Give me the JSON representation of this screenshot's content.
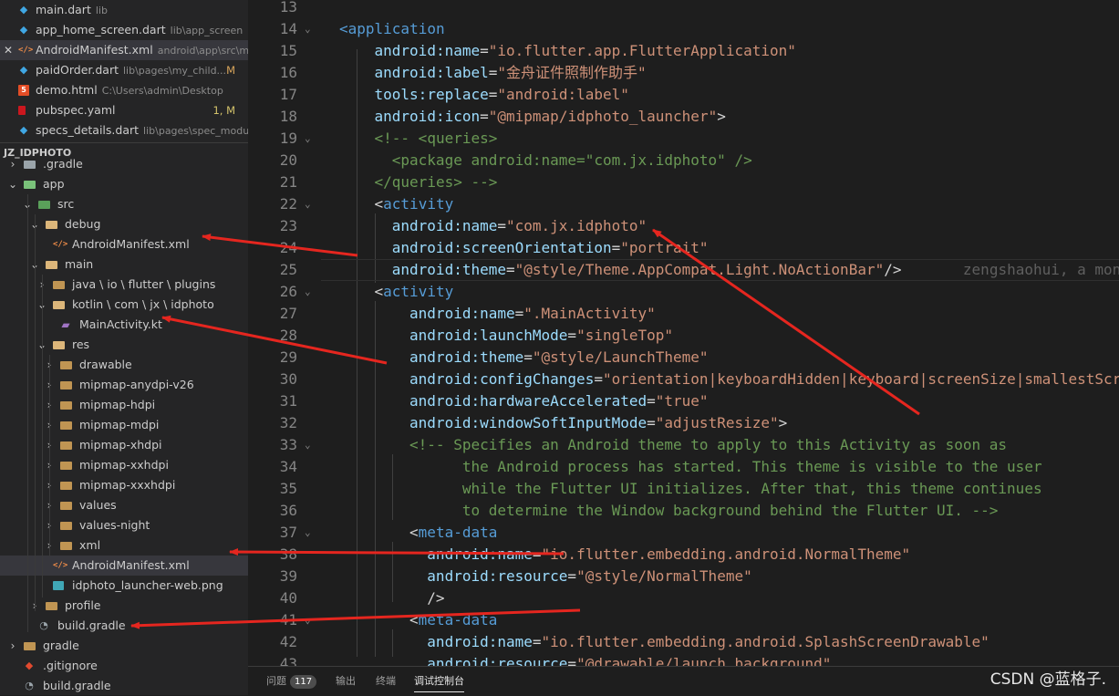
{
  "open_editors": [
    {
      "name": "main.dart",
      "hint": "lib",
      "icon": "dart",
      "badge": ""
    },
    {
      "name": "app_home_screen.dart",
      "hint": "lib\\app_screen",
      "icon": "dart",
      "badge": ""
    },
    {
      "name": "AndroidManifest.xml",
      "hint": "android\\app\\src\\m...",
      "icon": "xml",
      "badge": "",
      "selected": true
    },
    {
      "name": "paidOrder.dart",
      "hint": "lib\\pages\\my_child...",
      "icon": "dart",
      "badge": "M"
    },
    {
      "name": "demo.html",
      "hint": "C:\\Users\\admin\\Desktop",
      "icon": "html",
      "badge": ""
    },
    {
      "name": "pubspec.yaml",
      "hint": "",
      "icon": "yaml",
      "badge": "1, M"
    },
    {
      "name": "specs_details.dart",
      "hint": "lib\\pages\\spec_module",
      "icon": "dart",
      "badge": ""
    }
  ],
  "close_glyph": "✕",
  "workspace_title": "JZ_IDPHOTO",
  "tree": [
    {
      "label": ".gradle",
      "depth": 0,
      "kind": "folder-gr",
      "chev": "›"
    },
    {
      "label": "app",
      "depth": 0,
      "kind": "folder-app",
      "chev": "⌄"
    },
    {
      "label": "src",
      "depth": 1,
      "kind": "folder-src",
      "chev": "⌄"
    },
    {
      "label": "debug",
      "depth": 2,
      "kind": "folder-open",
      "chev": "⌄"
    },
    {
      "label": "AndroidManifest.xml",
      "depth": 3,
      "kind": "xml",
      "chev": ""
    },
    {
      "label": "main",
      "depth": 2,
      "kind": "folder-open",
      "chev": "⌄"
    },
    {
      "label": "java \\ io \\ flutter \\ plugins",
      "depth": 3,
      "kind": "folder",
      "chev": "›"
    },
    {
      "label": "kotlin \\ com \\ jx \\ idphoto",
      "depth": 3,
      "kind": "folder-open",
      "chev": "⌄"
    },
    {
      "label": "MainActivity.kt",
      "depth": 4,
      "kind": "kt",
      "chev": ""
    },
    {
      "label": "res",
      "depth": 3,
      "kind": "folder-open",
      "chev": "⌄"
    },
    {
      "label": "drawable",
      "depth": 4,
      "kind": "folder",
      "chev": "›"
    },
    {
      "label": "mipmap-anydpi-v26",
      "depth": 4,
      "kind": "folder",
      "chev": "›"
    },
    {
      "label": "mipmap-hdpi",
      "depth": 4,
      "kind": "folder",
      "chev": "›"
    },
    {
      "label": "mipmap-mdpi",
      "depth": 4,
      "kind": "folder",
      "chev": "›"
    },
    {
      "label": "mipmap-xhdpi",
      "depth": 4,
      "kind": "folder",
      "chev": "›"
    },
    {
      "label": "mipmap-xxhdpi",
      "depth": 4,
      "kind": "folder",
      "chev": "›"
    },
    {
      "label": "mipmap-xxxhdpi",
      "depth": 4,
      "kind": "folder",
      "chev": "›"
    },
    {
      "label": "values",
      "depth": 4,
      "kind": "folder",
      "chev": "›"
    },
    {
      "label": "values-night",
      "depth": 4,
      "kind": "folder",
      "chev": "›"
    },
    {
      "label": "xml",
      "depth": 4,
      "kind": "folder",
      "chev": "›"
    },
    {
      "label": "AndroidManifest.xml",
      "depth": 3,
      "kind": "xml",
      "chev": "",
      "selected": true
    },
    {
      "label": "idphoto_launcher-web.png",
      "depth": 3,
      "kind": "png",
      "chev": ""
    },
    {
      "label": "profile",
      "depth": 2,
      "kind": "folder",
      "chev": "›"
    },
    {
      "label": "build.gradle",
      "depth": 1,
      "kind": "gradle",
      "chev": ""
    },
    {
      "label": "gradle",
      "depth": 0,
      "kind": "folder",
      "chev": "›"
    },
    {
      "label": ".gitignore",
      "depth": 0,
      "kind": "git",
      "chev": ""
    },
    {
      "label": "build.gradle",
      "depth": 0,
      "kind": "gradle",
      "chev": ""
    }
  ],
  "editor": {
    "lines": [
      {
        "n": "13",
        "fold": "",
        "indent": 0,
        "tokens": []
      },
      {
        "n": "14",
        "fold": "⌄",
        "indent": 0,
        "tokens": [
          [
            "tag",
            "<application"
          ]
        ]
      },
      {
        "n": "15",
        "fold": "",
        "indent": 2,
        "tokens": [
          [
            "attr",
            "android:name"
          ],
          [
            "pl",
            "="
          ],
          [
            "str",
            "\"io.flutter.app.FlutterApplication\""
          ]
        ]
      },
      {
        "n": "16",
        "fold": "",
        "indent": 2,
        "tokens": [
          [
            "attr",
            "android:label"
          ],
          [
            "pl",
            "="
          ],
          [
            "str",
            "\"金舟证件照制作助手\""
          ]
        ]
      },
      {
        "n": "17",
        "fold": "",
        "indent": 2,
        "tokens": [
          [
            "attr",
            "tools:replace"
          ],
          [
            "pl",
            "="
          ],
          [
            "str",
            "\"android:label\""
          ]
        ]
      },
      {
        "n": "18",
        "fold": "",
        "indent": 2,
        "tokens": [
          [
            "attr",
            "android:icon"
          ],
          [
            "pl",
            "="
          ],
          [
            "str",
            "\"@mipmap/idphoto_launcher\""
          ],
          [
            "pl",
            ">"
          ]
        ]
      },
      {
        "n": "19",
        "fold": "⌄",
        "indent": 2,
        "tokens": [
          [
            "cm",
            "<!-- <queries>"
          ]
        ]
      },
      {
        "n": "20",
        "fold": "",
        "indent": 3,
        "tokens": [
          [
            "cm",
            "<package android:name=\"com.jx.idphoto\" />"
          ]
        ]
      },
      {
        "n": "21",
        "fold": "",
        "indent": 2,
        "tokens": [
          [
            "cm",
            "</queries> -->"
          ]
        ]
      },
      {
        "n": "22",
        "fold": "⌄",
        "indent": 2,
        "tokens": [
          [
            "pl",
            "<"
          ],
          [
            "tag",
            "activity"
          ]
        ]
      },
      {
        "n": "23",
        "fold": "",
        "indent": 3,
        "tokens": [
          [
            "attr",
            "android:name"
          ],
          [
            "pl",
            "="
          ],
          [
            "str",
            "\"com.jx.idphoto\""
          ]
        ]
      },
      {
        "n": "24",
        "fold": "",
        "indent": 3,
        "tokens": [
          [
            "attr",
            "android:screenOrientation"
          ],
          [
            "pl",
            "="
          ],
          [
            "str",
            "\"portrait\""
          ]
        ]
      },
      {
        "n": "25",
        "fold": "",
        "indent": 3,
        "current": true,
        "tokens": [
          [
            "attr",
            "android:theme"
          ],
          [
            "pl",
            "="
          ],
          [
            "str",
            "\"@style/Theme.AppCompat.Light.NoActionBar\""
          ],
          [
            "pl",
            "/>"
          ],
          [
            "blame",
            "       zengshaohui, a month ago"
          ]
        ]
      },
      {
        "n": "26",
        "fold": "⌄",
        "indent": 2,
        "tokens": [
          [
            "pl",
            "<"
          ],
          [
            "tag",
            "activity"
          ]
        ]
      },
      {
        "n": "27",
        "fold": "",
        "indent": 4,
        "tokens": [
          [
            "attr",
            "android:name"
          ],
          [
            "pl",
            "="
          ],
          [
            "str",
            "\".MainActivity\""
          ]
        ]
      },
      {
        "n": "28",
        "fold": "",
        "indent": 4,
        "tokens": [
          [
            "attr",
            "android:launchMode"
          ],
          [
            "pl",
            "="
          ],
          [
            "str",
            "\"singleTop\""
          ]
        ]
      },
      {
        "n": "29",
        "fold": "",
        "indent": 4,
        "tokens": [
          [
            "attr",
            "android:theme"
          ],
          [
            "pl",
            "="
          ],
          [
            "str",
            "\"@style/LaunchTheme\""
          ]
        ]
      },
      {
        "n": "30",
        "fold": "",
        "indent": 4,
        "tokens": [
          [
            "attr",
            "android:configChanges"
          ],
          [
            "pl",
            "="
          ],
          [
            "str",
            "\"orientation|keyboardHidden|keyboard|screenSize|smallestScreenSize\""
          ]
        ]
      },
      {
        "n": "31",
        "fold": "",
        "indent": 4,
        "tokens": [
          [
            "attr",
            "android:hardwareAccelerated"
          ],
          [
            "pl",
            "="
          ],
          [
            "str",
            "\"true\""
          ]
        ]
      },
      {
        "n": "32",
        "fold": "",
        "indent": 4,
        "tokens": [
          [
            "attr",
            "android:windowSoftInputMode"
          ],
          [
            "pl",
            "="
          ],
          [
            "str",
            "\"adjustResize\""
          ],
          [
            "pl",
            ">"
          ]
        ]
      },
      {
        "n": "33",
        "fold": "⌄",
        "indent": 4,
        "tokens": [
          [
            "cm",
            "<!-- Specifies an Android theme to apply to this Activity as soon as"
          ]
        ]
      },
      {
        "n": "34",
        "fold": "",
        "indent": 7,
        "tokens": [
          [
            "cm",
            "the Android process has started. This theme is visible to the user"
          ]
        ]
      },
      {
        "n": "35",
        "fold": "",
        "indent": 7,
        "tokens": [
          [
            "cm",
            "while the Flutter UI initializes. After that, this theme continues"
          ]
        ]
      },
      {
        "n": "36",
        "fold": "",
        "indent": 7,
        "tokens": [
          [
            "cm",
            "to determine the Window background behind the Flutter UI. -->"
          ]
        ]
      },
      {
        "n": "37",
        "fold": "⌄",
        "indent": 4,
        "tokens": [
          [
            "pl",
            "<"
          ],
          [
            "tag",
            "meta-data"
          ]
        ]
      },
      {
        "n": "38",
        "fold": "",
        "indent": 5,
        "tokens": [
          [
            "attr",
            "android:name"
          ],
          [
            "pl",
            "="
          ],
          [
            "str",
            "\"io.flutter.embedding.android.NormalTheme\""
          ]
        ]
      },
      {
        "n": "39",
        "fold": "",
        "indent": 5,
        "tokens": [
          [
            "attr",
            "android:resource"
          ],
          [
            "pl",
            "="
          ],
          [
            "str",
            "\"@style/NormalTheme\""
          ]
        ]
      },
      {
        "n": "40",
        "fold": "",
        "indent": 5,
        "tokens": [
          [
            "pl",
            "/>"
          ]
        ]
      },
      {
        "n": "41",
        "fold": "⌄",
        "indent": 4,
        "tokens": [
          [
            "pl",
            "<"
          ],
          [
            "tag",
            "meta-data"
          ]
        ]
      },
      {
        "n": "42",
        "fold": "",
        "indent": 5,
        "tokens": [
          [
            "attr",
            "android:name"
          ],
          [
            "pl",
            "="
          ],
          [
            "str",
            "\"io.flutter.embedding.android.SplashScreenDrawable\""
          ]
        ]
      },
      {
        "n": "43",
        "fold": "",
        "indent": 5,
        "tokens": [
          [
            "attr",
            "android:resource"
          ],
          [
            "pl",
            "="
          ],
          [
            "str",
            "\"@drawable/launch_background\""
          ]
        ]
      }
    ]
  },
  "panel": {
    "tabs": [
      {
        "label": "问题",
        "badge": "117"
      },
      {
        "label": "输出",
        "badge": ""
      },
      {
        "label": "终端",
        "badge": ""
      },
      {
        "label": "调试控制台",
        "badge": "",
        "active": true
      }
    ]
  },
  "watermark": "CSDN @蓝格子.",
  "colors": {
    "arrow": "#e5261f",
    "selection": "#37373d",
    "sidebar": "#252526",
    "editor": "#1e1e1e"
  }
}
